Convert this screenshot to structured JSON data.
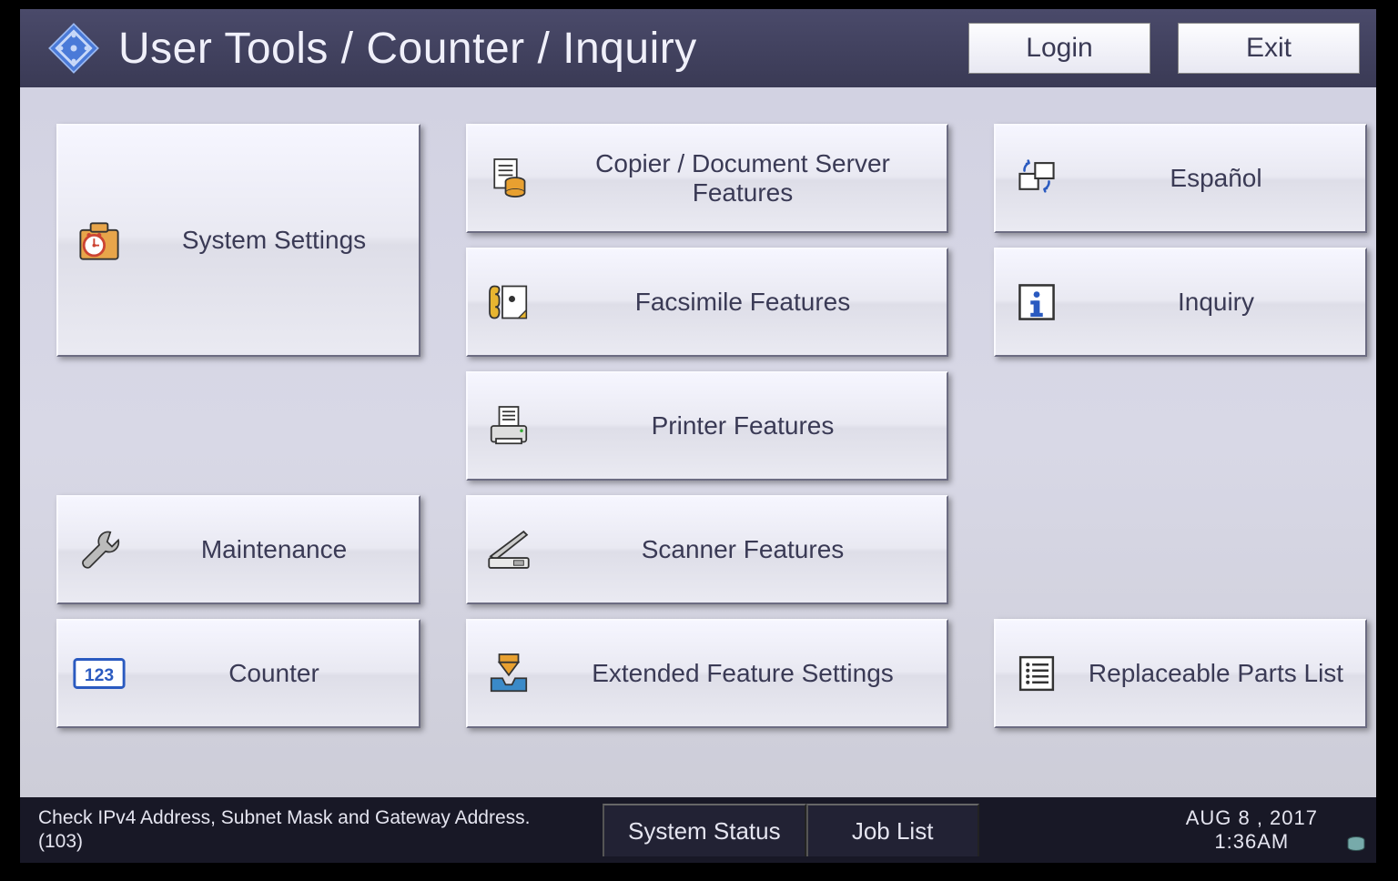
{
  "header": {
    "title": "User Tools / Counter / Inquiry",
    "login_label": "Login",
    "exit_label": "Exit"
  },
  "tiles": {
    "system": "System Settings",
    "maint": "Maintenance",
    "counter": "Counter",
    "copier": "Copier / Document Server Features",
    "fax": "Facsimile Features",
    "printer": "Printer Features",
    "scanner": "Scanner Features",
    "extended": "Extended Feature Settings",
    "lang": "Español",
    "inquiry": "Inquiry",
    "parts": "Replaceable Parts List"
  },
  "footer": {
    "status_line1": "Check IPv4 Address, Subnet Mask and Gateway Address.",
    "status_line2": "(103)",
    "system_status": "System Status",
    "job_list": "Job List",
    "date": "AUG    8 , 2017",
    "time": "1:36AM"
  }
}
